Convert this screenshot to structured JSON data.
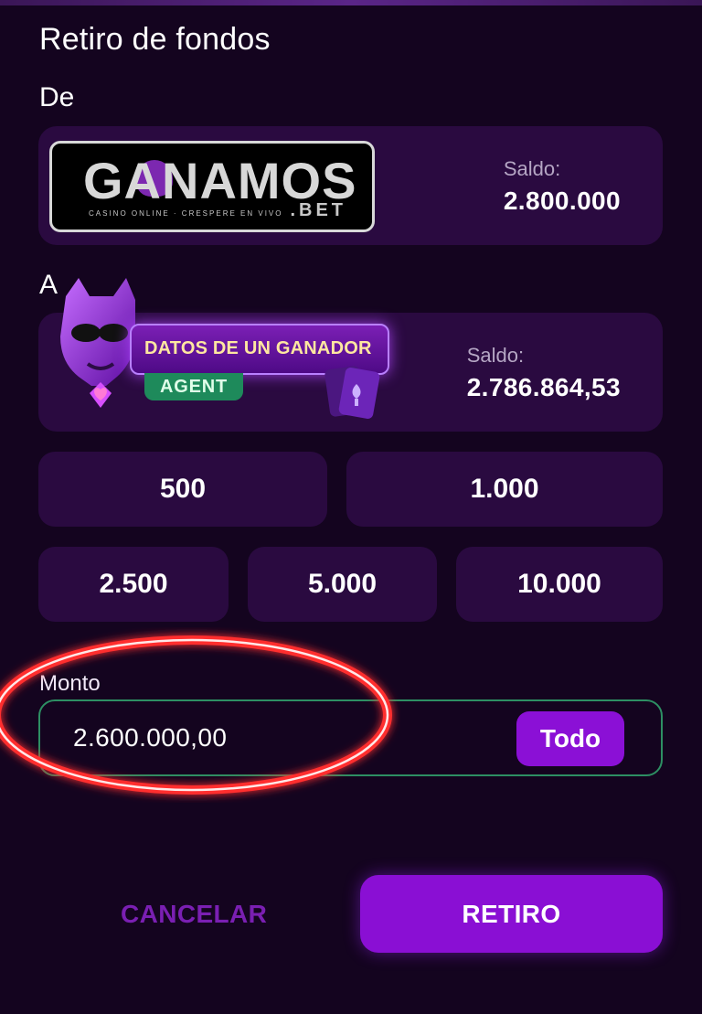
{
  "header": {
    "title": "Retiro de fondos"
  },
  "from_section": {
    "label": "De",
    "logo": {
      "word": "GANAMOS",
      "subtext": "CASINO ONLINE · CRESPERE EN VIVO",
      "suffix": ".BET"
    },
    "balance_label": "Saldo:",
    "balance_value": "2.800.000"
  },
  "to_section": {
    "label": "A",
    "logo": {
      "banner_text": "DATOS DE UN GANADOR",
      "pill_text": "AGENT"
    },
    "balance_label": "Saldo:",
    "balance_value": "2.786.864,53"
  },
  "quick_amounts": [
    "500",
    "1.000",
    "2.500",
    "5.000",
    "10.000"
  ],
  "amount_field": {
    "label": "Monto",
    "value": "2.600.000,00",
    "all_label": "Todo"
  },
  "actions": {
    "cancel_label": "CANCELAR",
    "submit_label": "RETIRO"
  },
  "colors": {
    "background": "#14041f",
    "card": "#2a0a40",
    "primary": "#8a0fd4",
    "accent_green": "#2d8f63",
    "highlight_red": "#ff2f2f"
  }
}
